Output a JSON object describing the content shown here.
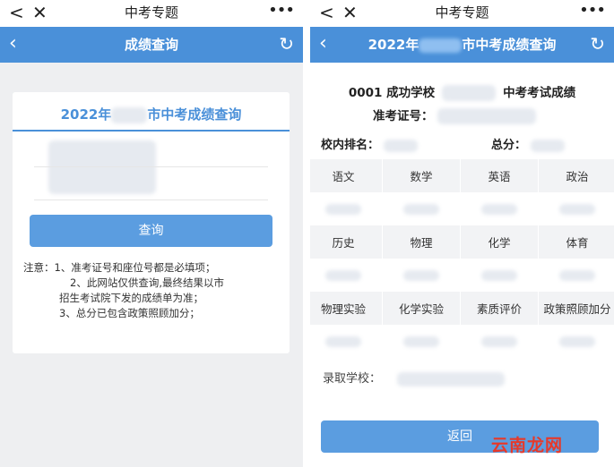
{
  "left": {
    "wx_title": "中考专题",
    "header_title": "成绩查询",
    "card_title_prefix": "2022年",
    "card_title_suffix": "市中考成绩查询",
    "query_button": "查询",
    "notes": [
      "注意：1、准考证号和座位号都是必填项；",
      "2、此网站仅供查询,最终结果以市",
      "招生考试院下发的成绩单为准；",
      "3、总分已包含政策照顾加分；"
    ]
  },
  "right": {
    "wx_title": "中考专题",
    "header_title_prefix": "2022年",
    "header_title_suffix": "市中考成绩查询",
    "school_line_prefix": "0001 成功学校",
    "school_line_suffix": "中考考试成绩",
    "ticket_label": "准考证号：",
    "rank_label": "校内排名：",
    "total_label": "总分：",
    "subjects_row1": [
      "语文",
      "数学",
      "英语",
      "政治"
    ],
    "subjects_row2": [
      "历史",
      "物理",
      "化学",
      "体育"
    ],
    "subjects_row3": [
      "物理实验",
      "化学实验",
      "素质评价",
      "政策照顾加分"
    ],
    "enroll_label": "录取学校：",
    "back_button": "返回"
  },
  "watermark": "云南龙网",
  "colors": {
    "accent": "#4a90d9",
    "button": "#5b9de0",
    "watermark": "#e6392a"
  }
}
